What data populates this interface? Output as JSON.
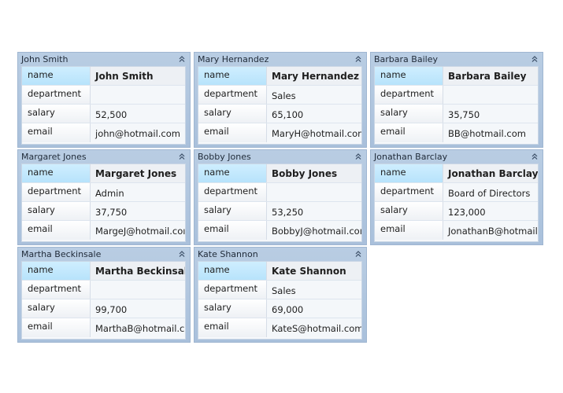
{
  "labels": {
    "name": "name",
    "department": "department",
    "salary": "salary",
    "email": "email"
  },
  "cards": [
    {
      "title": "John Smith",
      "name": "John Smith",
      "department": "",
      "salary": "52,500",
      "email": "john@hotmail.com"
    },
    {
      "title": "Mary Hernandez",
      "name": "Mary Hernandez",
      "department": "Sales",
      "salary": "65,100",
      "email": "MaryH@hotmail.con"
    },
    {
      "title": "Barbara Bailey",
      "name": "Barbara Bailey",
      "department": "",
      "salary": "35,750",
      "email": "BB@hotmail.com"
    },
    {
      "title": "Margaret Jones",
      "name": "Margaret Jones",
      "department": "Admin",
      "salary": "37,750",
      "email": "MargeJ@hotmail.coı"
    },
    {
      "title": "Bobby Jones",
      "name": "Bobby Jones",
      "department": "",
      "salary": "53,250",
      "email": "BobbyJ@hotmail.coı"
    },
    {
      "title": "Jonathan Barclay",
      "name": "Jonathan Barclay",
      "department": "Board of Directors",
      "salary": "123,000",
      "email": "JonathanB@hotmail."
    },
    {
      "title": "Martha Beckinsale",
      "name": "Martha Beckinsale",
      "department": "",
      "salary": "99,700",
      "email": "MarthaB@hotmail.cc"
    },
    {
      "title": "Kate Shannon",
      "name": "Kate Shannon",
      "department": "Sales",
      "salary": "69,000",
      "email": "KateS@hotmail.com"
    }
  ],
  "icons": {
    "collapse": "chevron-double-up-icon"
  },
  "colors": {
    "header": "#b9cde3",
    "selected_label": "#b7e3fb"
  }
}
